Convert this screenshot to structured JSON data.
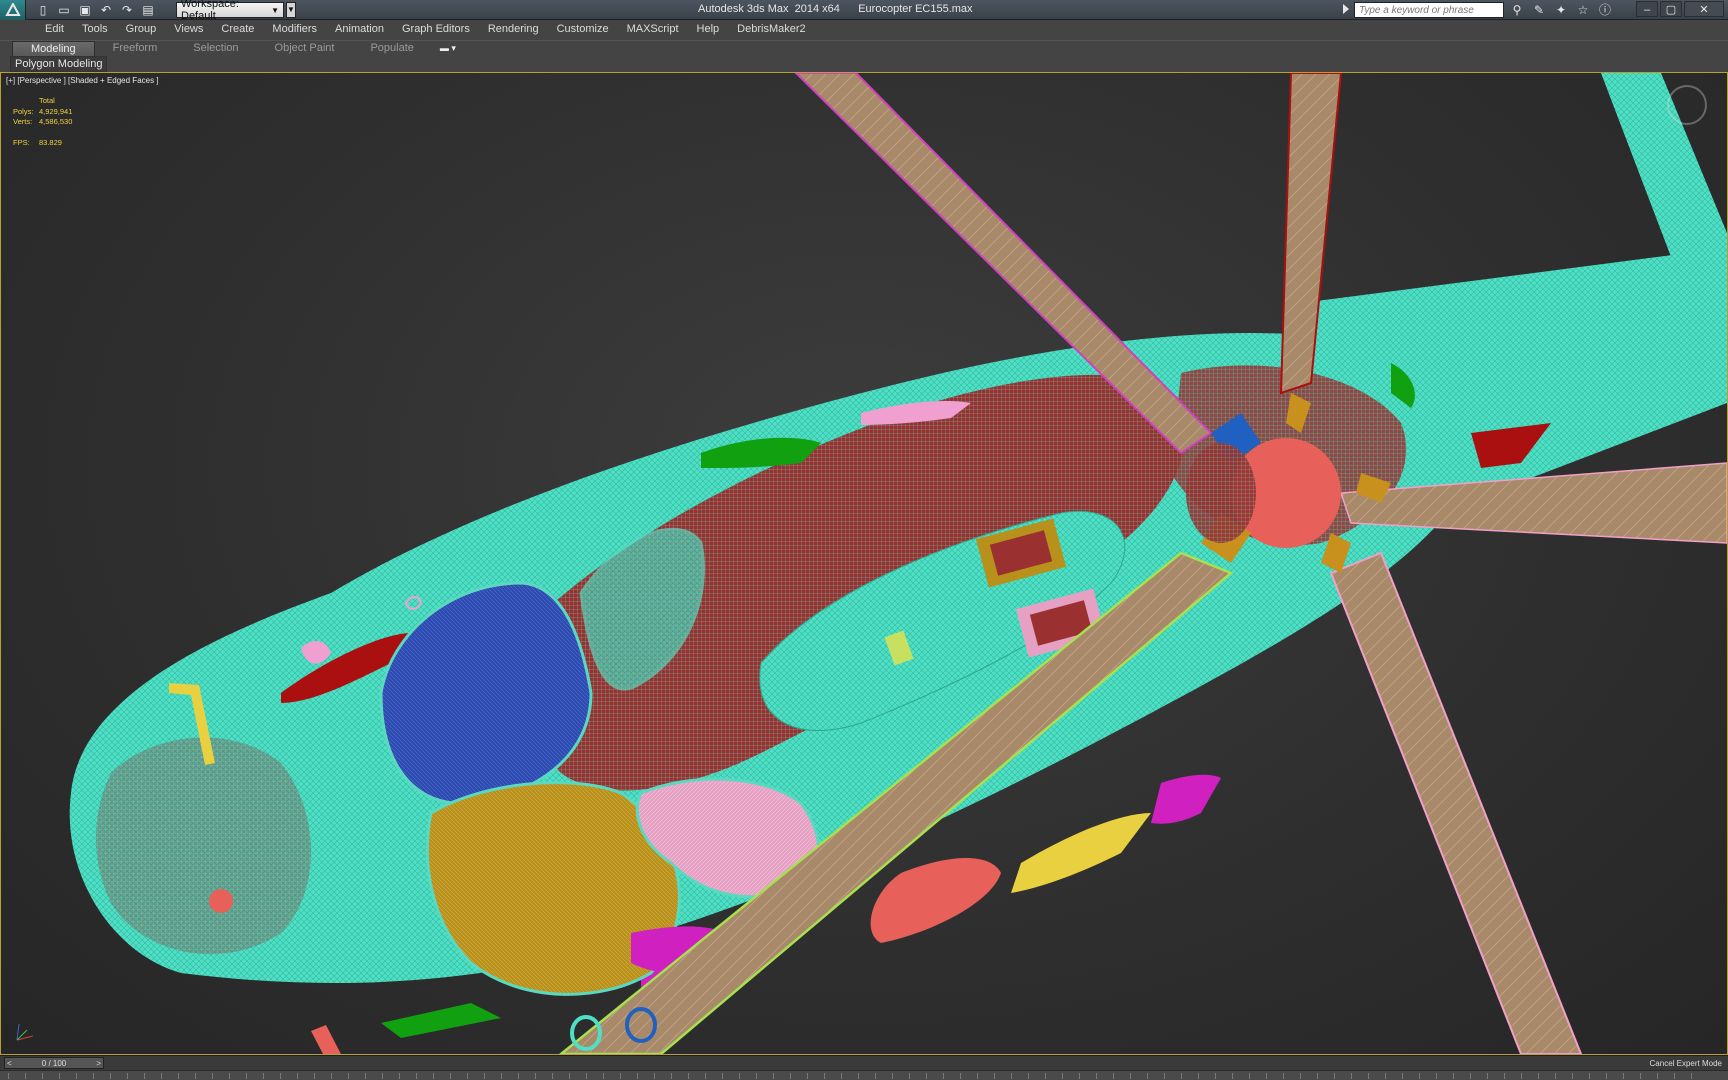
{
  "titlebar": {
    "app_name": "Autodesk 3ds Max  2014 x64",
    "file_name": "Eurocopter EC155.max",
    "workspace": "Workspace: Default",
    "search_placeholder": "Type a keyword or phrase",
    "quick_access_icons": [
      "new-icon",
      "open-icon",
      "save-icon",
      "undo-icon",
      "redo-icon",
      "project-icon"
    ],
    "help_icons": [
      "binoculars-icon",
      "tools-icon",
      "star-icon",
      "favorites-icon",
      "help-icon"
    ],
    "window_buttons": [
      "minimize",
      "maximize",
      "close"
    ]
  },
  "menu": {
    "items": [
      "Edit",
      "Tools",
      "Group",
      "Views",
      "Create",
      "Modifiers",
      "Animation",
      "Graph Editors",
      "Rendering",
      "Customize",
      "MAXScript",
      "Help",
      "DebrisMaker2"
    ]
  },
  "ribbon": {
    "tabs": [
      "Modeling",
      "Freeform",
      "Selection",
      "Object Paint",
      "Populate"
    ],
    "active_tab": "Modeling",
    "panel": "Polygon Modeling"
  },
  "viewport": {
    "label": "[+] [Perspective ] [Shaded + Edged Faces ]",
    "stats": {
      "header": "Total",
      "polys_label": "Polys:",
      "polys": "4,929,941",
      "verts_label": "Verts:",
      "verts": "4,586,530",
      "fps_label": "FPS:",
      "fps": "83.829"
    },
    "colors": {
      "body": "#4ee0c4",
      "wire": "#8b1a1a",
      "blade": "#a88a6a",
      "hub": "#e8605a",
      "glass_blue": "#3050b8",
      "glass_yellow": "#c8a020",
      "glass_pink": "#e8a0c8",
      "green": "#10a010"
    }
  },
  "timeline": {
    "frame": "0 / 100"
  },
  "status": {
    "expert_mode": "Cancel Expert Mode"
  }
}
